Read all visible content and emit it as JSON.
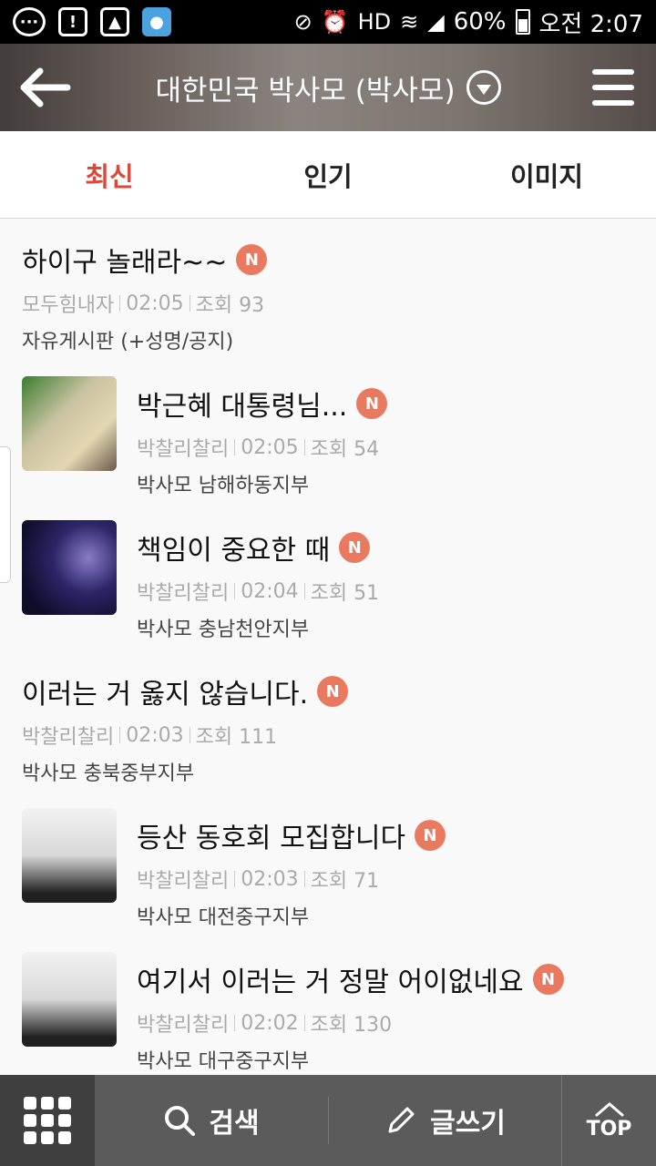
{
  "status_bar": {
    "battery": "60%",
    "time": "오전 2:07",
    "icons": [
      "message-icon",
      "alert-icon",
      "image-icon",
      "app-icon",
      "mute-icon",
      "alarm-icon",
      "hd-icon",
      "wifi-icon",
      "signal-icon",
      "battery-icon"
    ],
    "hd_label": "HD",
    "alert_label": "!"
  },
  "header": {
    "title": "대한민국 박사모 (박사모)"
  },
  "tabs": [
    {
      "label": "최신",
      "active": true
    },
    {
      "label": "인기",
      "active": false
    },
    {
      "label": "이미지",
      "active": false
    }
  ],
  "badge_label": "N",
  "posts": [
    {
      "title": "하이구 놀래라~~",
      "author": "모두힘내자",
      "time": "02:05",
      "views": "조회 93",
      "board": "자유게시판 (+성명/공지)"
    },
    {
      "title": "박근혜 대통령님...",
      "author": "박찰리찰리",
      "time": "02:05",
      "views": "조회 54",
      "board": "박사모 남해하동지부"
    },
    {
      "title": "책임이 중요한 때",
      "author": "박찰리찰리",
      "time": "02:04",
      "views": "조회 51",
      "board": "박사모 충남천안지부"
    },
    {
      "title": "이러는 거 옳지 않습니다.",
      "author": "박찰리찰리",
      "time": "02:03",
      "views": "조회 111",
      "board": "박사모 충북중부지부"
    },
    {
      "title": "등산 동호회 모집합니다",
      "author": "박찰리찰리",
      "time": "02:03",
      "views": "조회 71",
      "board": "박사모 대전중구지부"
    },
    {
      "title": "여기서 이러는 거 정말 어이없네요",
      "author": "박찰리찰리",
      "time": "02:02",
      "views": "조회 130",
      "board": "박사모 대구중구지부"
    }
  ],
  "bottom_bar": {
    "search_label": "검색",
    "write_label": "글쓰기",
    "top_label": "TOP"
  }
}
